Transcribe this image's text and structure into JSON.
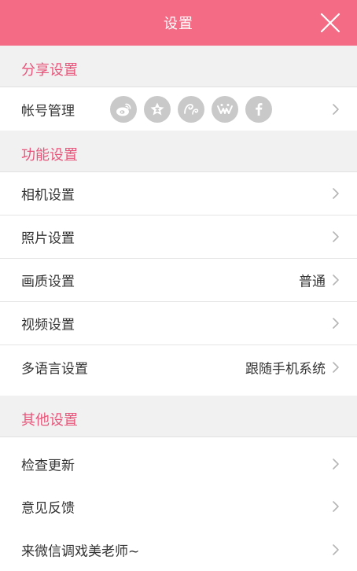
{
  "header": {
    "title": "设置",
    "close_icon": "close-icon",
    "background": "#f36b85"
  },
  "sections": [
    {
      "title": "分享设置",
      "rows": [
        {
          "label": "帐号管理",
          "icons": [
            "weibo-icon",
            "favorite-star-icon",
            "wechat-moments-icon",
            "qzone-icon",
            "facebook-icon"
          ]
        }
      ]
    },
    {
      "title": "功能设置",
      "rows": [
        {
          "label": "相机设置",
          "value": ""
        },
        {
          "label": "照片设置",
          "value": ""
        },
        {
          "label": "画质设置",
          "value": "普通"
        },
        {
          "label": "视频设置",
          "value": ""
        },
        {
          "label": "多语言设置",
          "value": "跟随手机系统"
        }
      ]
    },
    {
      "title": "其他设置",
      "rows": [
        {
          "label": "检查更新",
          "value": ""
        },
        {
          "label": "意见反馈",
          "value": ""
        },
        {
          "label": "来微信调戏美老师~",
          "value": ""
        }
      ]
    }
  ],
  "colors": {
    "accent": "#f36b85",
    "section_title": "#e8557a",
    "section_bg": "#f1f1f1",
    "icon_bg": "#c9c9c9"
  }
}
